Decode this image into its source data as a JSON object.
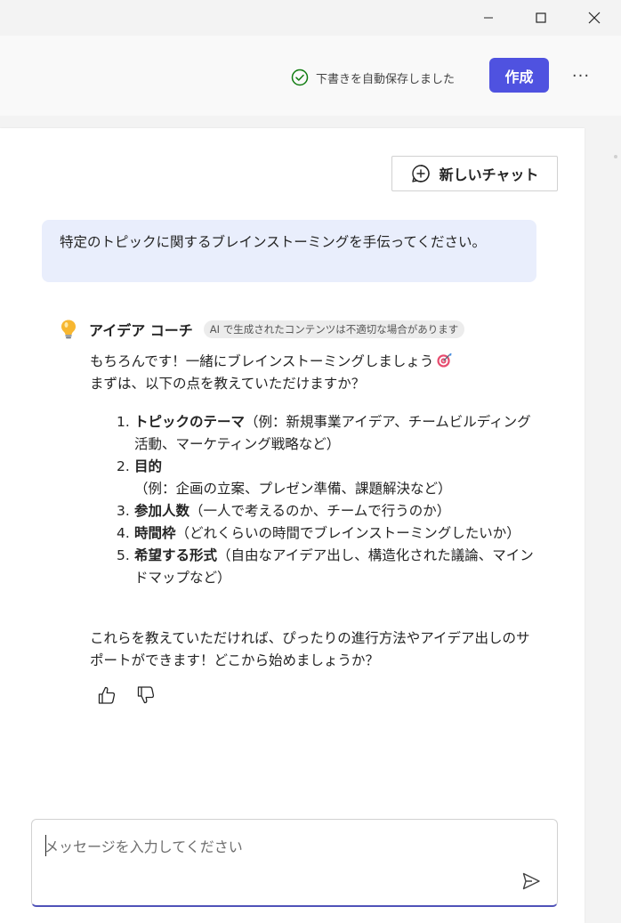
{
  "toolbar": {
    "autosave_text": "下書きを自動保存しました",
    "create_label": "作成",
    "more_label": "···"
  },
  "chat": {
    "new_chat_label": "新しいチャット",
    "user_message": "特定のトピックに関するブレインストーミングを手伝ってください。",
    "assistant": {
      "name": "アイデア コーチ",
      "ai_notice": "AI で生成されたコンテンツは不適切な場合があります",
      "intro_line1": "もちろんです！一緒にブレインストーミングしましょう",
      "intro_line2": "まずは、以下の点を教えていただけますか？",
      "items": [
        {
          "num": "1.",
          "title": "トピックのテーマ",
          "detail": "（例：新規事業アイデア、チームビルディング活動、マーケティング戦略など）"
        },
        {
          "num": "2.",
          "title": "目的",
          "detail": "（例：企画の立案、プレゼン準備、課題解決など）"
        },
        {
          "num": "3.",
          "title": "参加人数",
          "detail": "（一人で考えるのか、チームで行うのか）"
        },
        {
          "num": "4.",
          "title": "時間枠",
          "detail": "（どれくらいの時間でブレインストーミングしたいか）"
        },
        {
          "num": "5.",
          "title": "希望する形式",
          "detail": "（自由なアイデア出し、構造化された議論、マインドマップなど）"
        }
      ],
      "closing": "これらを教えていただければ、ぴったりの進行方法やアイデア出しのサポートができます！どこから始めましょうか？"
    },
    "input_placeholder": "メッセージを入力してください"
  },
  "colors": {
    "accent": "#4f52e0",
    "user_bubble": "#e9eefc",
    "check_green": "#107c10"
  }
}
